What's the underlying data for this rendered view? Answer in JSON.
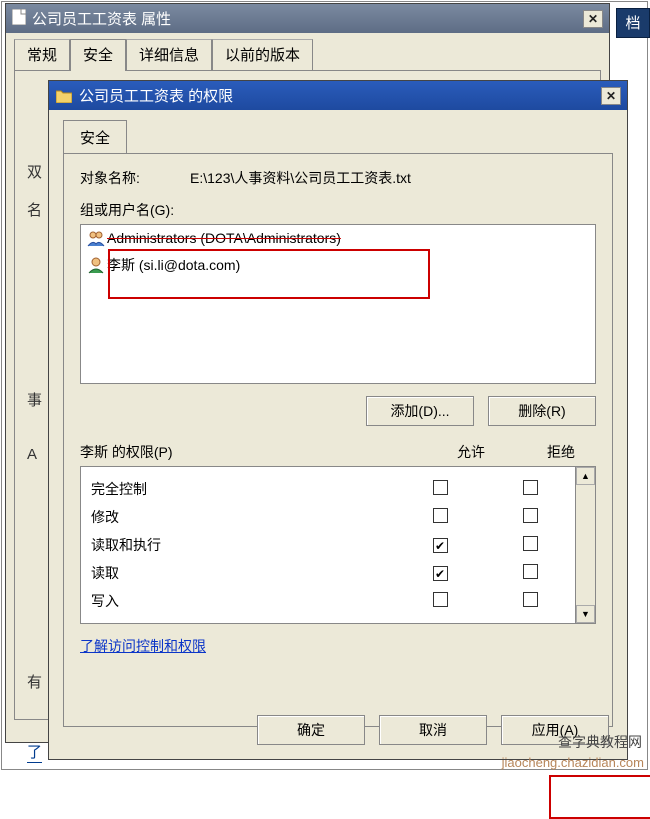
{
  "main_window": {
    "title": "公司员工工资表 属性",
    "tabs": [
      "常规",
      "安全",
      "详细信息",
      "以前的版本"
    ],
    "active_tab_index": 1
  },
  "rightstrip": "档",
  "left_hints": {
    "h1": "双",
    "h2": "名",
    "h3": "事",
    "h4": "A",
    "h5": "有",
    "h6": "了"
  },
  "perm_window": {
    "title": "公司员工工资表 的权限",
    "tab": "安全",
    "object_label": "对象名称:",
    "object_path": "E:\\123\\人事资料\\公司员工工资表.txt",
    "group_label": "组或用户名(G):",
    "users": [
      {
        "text": "Administrators (DOTA\\Administrators)",
        "strike": true,
        "icon": "admins"
      },
      {
        "text": "李斯 (si.li@dota.com)",
        "strike": false,
        "icon": "user"
      }
    ],
    "add_btn": "添加(D)...",
    "remove_btn": "删除(R)",
    "perm_title_user": "李斯 的权限(P)",
    "allow_header": "允许",
    "deny_header": "拒绝",
    "permissions": [
      {
        "label": "完全控制",
        "allow": false,
        "deny": false
      },
      {
        "label": "修改",
        "allow": false,
        "deny": false
      },
      {
        "label": "读取和执行",
        "allow": true,
        "deny": false
      },
      {
        "label": "读取",
        "allow": true,
        "deny": false
      },
      {
        "label": "写入",
        "allow": false,
        "deny": false
      }
    ],
    "help_link": "了解访问控制和权限",
    "ok_btn": "确定",
    "cancel_btn": "取消",
    "apply_btn": "应用(A)"
  },
  "watermark_primary": "查字典教程网",
  "watermark_url": "jiaocheng.chazidian.com"
}
